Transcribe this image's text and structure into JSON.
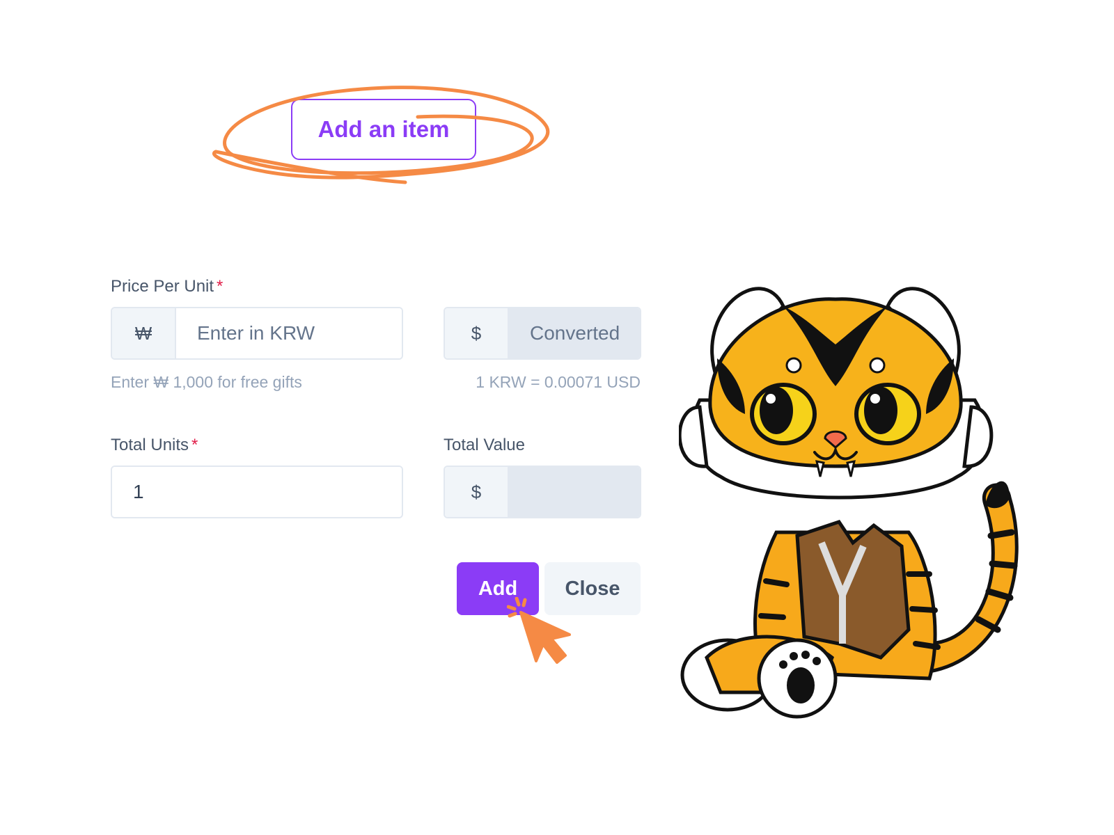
{
  "top_button": {
    "label": "Add an item"
  },
  "form": {
    "price_per_unit": {
      "label": "Price Per Unit",
      "required_mark": "*",
      "currency_symbol": "₩",
      "placeholder": "Enter in KRW",
      "value": "",
      "help": "Enter ₩ 1,000 for free gifts"
    },
    "converted": {
      "currency_symbol": "$",
      "placeholder": "Converted",
      "value": "",
      "rate_note": "1 KRW = 0.00071 USD"
    },
    "total_units": {
      "label": "Total Units",
      "required_mark": "*",
      "value": "1"
    },
    "total_value": {
      "label": "Total Value",
      "currency_symbol": "$",
      "value": ""
    },
    "buttons": {
      "add_label": "Add",
      "close_label": "Close"
    }
  },
  "colors": {
    "accent": "#8b3cf6",
    "annotation": "#f58a45",
    "required": "#e11d48",
    "muted_bg": "#f1f5f9",
    "readonly_bg": "#e2e8f0"
  },
  "icons": [
    "pointer-cursor-icon",
    "click-burst-icon",
    "tiger-mascot-illustration"
  ]
}
